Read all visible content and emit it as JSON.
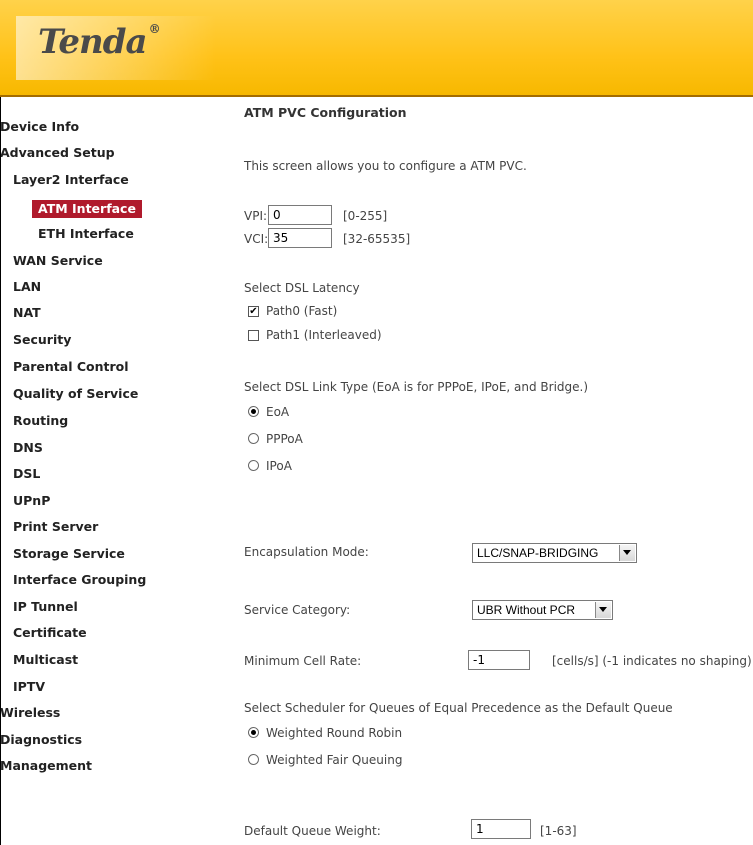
{
  "brand": {
    "logo_text": "Tenda",
    "logo_mark": "®"
  },
  "sidebar": {
    "items": [
      {
        "label": "Device Info"
      },
      {
        "label": "Advanced Setup"
      },
      {
        "label": "Layer2 Interface"
      },
      {
        "label": "ATM Interface"
      },
      {
        "label": "ETH Interface"
      },
      {
        "label": "WAN Service"
      },
      {
        "label": "LAN"
      },
      {
        "label": "NAT"
      },
      {
        "label": "Security"
      },
      {
        "label": "Parental Control"
      },
      {
        "label": "Quality of Service"
      },
      {
        "label": "Routing"
      },
      {
        "label": "DNS"
      },
      {
        "label": "DSL"
      },
      {
        "label": "UPnP"
      },
      {
        "label": "Print Server"
      },
      {
        "label": "Storage Service"
      },
      {
        "label": "Interface Grouping"
      },
      {
        "label": "IP Tunnel"
      },
      {
        "label": "Certificate"
      },
      {
        "label": "Multicast"
      },
      {
        "label": "IPTV"
      },
      {
        "label": "Wireless"
      },
      {
        "label": "Diagnostics"
      },
      {
        "label": "Management"
      }
    ],
    "active_item": "ATM Interface",
    "active_color": "#b01a2c"
  },
  "main": {
    "title": "ATM PVC Configuration",
    "description": "This screen allows you to configure a ATM PVC.",
    "vpi": {
      "label": "VPI:",
      "value": "0",
      "range": "[0-255]"
    },
    "vci": {
      "label": "VCI:",
      "value": "35",
      "range": "[32-65535]"
    },
    "latency": {
      "heading": "Select DSL Latency",
      "path0": {
        "label": "Path0 (Fast)",
        "checked": true,
        "mark": "✔"
      },
      "path1": {
        "label": "Path1 (Interleaved)",
        "checked": false
      }
    },
    "link_type": {
      "heading": "Select DSL Link Type (EoA is for PPPoE, IPoE, and Bridge.)",
      "options": [
        "EoA",
        "PPPoA",
        "IPoA"
      ],
      "selected": "EoA"
    },
    "encapsulation": {
      "label": "Encapsulation Mode:",
      "value": "LLC/SNAP-BRIDGING"
    },
    "service_category": {
      "label": "Service Category:",
      "value": "UBR Without PCR"
    },
    "min_cell_rate": {
      "label": "Minimum Cell Rate:",
      "value": "-1",
      "hint": "[cells/s] (-1 indicates no shaping)"
    },
    "scheduler": {
      "heading": "Select Scheduler for Queues of Equal Precedence as the Default Queue",
      "options": [
        "Weighted Round Robin",
        "Weighted Fair Queuing"
      ],
      "selected": "Weighted Round Robin"
    },
    "default_queue_weight": {
      "label": "Default Queue Weight:",
      "value": "1",
      "range": "[1-63]"
    }
  },
  "colors": {
    "header": "#ffc218",
    "accent": "#b01a2c"
  }
}
